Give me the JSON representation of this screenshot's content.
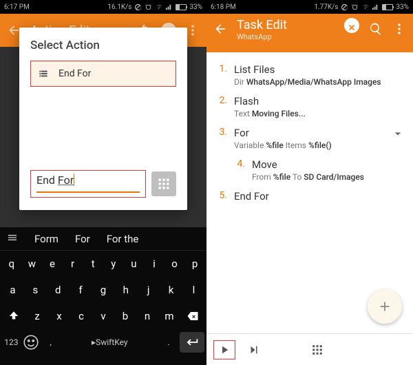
{
  "left": {
    "status": {
      "time": "6:17 PM",
      "net": "16.1K/s",
      "batt": "33%"
    },
    "header": {
      "title": "Action Edit"
    },
    "modal": {
      "title": "Select Action",
      "result_label": "End For",
      "input_prefix": "End ",
      "input_active": "For"
    },
    "keyboard": {
      "suggestions": [
        "Form",
        "For",
        "For the"
      ],
      "row1": [
        "q",
        "w",
        "e",
        "r",
        "t",
        "y",
        "u",
        "i",
        "o",
        "p"
      ],
      "row2": [
        "a",
        "s",
        "d",
        "f",
        "g",
        "h",
        "j",
        "k",
        "l"
      ],
      "row3": [
        "z",
        "x",
        "c",
        "v",
        "b",
        "n",
        "m"
      ],
      "nums_label": "123",
      "space_label": "SwiftKey",
      "comma": ",",
      "period": "."
    }
  },
  "right": {
    "status": {
      "time": "6:18 PM",
      "net": "1.77K/s",
      "batt": "33%"
    },
    "header": {
      "title": "Task Edit",
      "subtitle": "WhatsApp"
    },
    "tasks": [
      {
        "num": "1.",
        "title": "List Files",
        "sub_pre": "Dir ",
        "sub_bold": "WhatsApp/Media/WhatsApp Images",
        "sub_post": ""
      },
      {
        "num": "2.",
        "title": "Flash",
        "sub_pre": "Text ",
        "sub_bold": "Moving Files...",
        "sub_post": ""
      },
      {
        "num": "3.",
        "title": "For",
        "sub_pre": "Variable ",
        "sub_bold": "%file",
        "sub_mid": " Items ",
        "sub_bold2": "%file()",
        "expand": true
      },
      {
        "num": "4.",
        "title": "Move",
        "sub_pre": "From ",
        "sub_bold": "%file",
        "sub_mid": " To ",
        "sub_bold2": "SD Card/Images",
        "indent": true
      },
      {
        "num": "5.",
        "title": "End For"
      }
    ]
  }
}
